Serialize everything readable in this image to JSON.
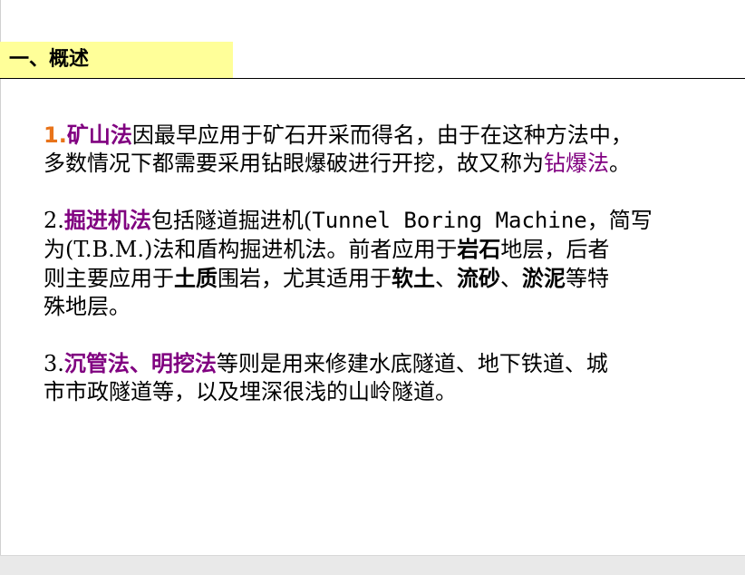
{
  "title": "一、概述",
  "p1": {
    "num": "1.",
    "term": "矿山法",
    "text1": "因最早应用于矿石开采而得名，由于在这种方法中，",
    "text2": "多数情况下都需要采用钻眼爆破进行开挖，故又称为",
    "term2": "钻爆法",
    "end": "。"
  },
  "p2": {
    "num": "2.",
    "term": "掘进机法",
    "text1": "包括隧道掘进机(",
    "english": "Tunnel Boring Machine",
    "text1b": "，简写",
    "text2a": "为(",
    "abbr": "T.B.M.",
    "text2b": ")法和盾构掘进机法。前者应用于",
    "rock": "岩石",
    "text2c": "地层，后者",
    "text3a": "则主要应用于",
    "soil": "土质",
    "text3b": "围岩，尤其适用于",
    "soft": "软土",
    "sep1": "、",
    "sand": "流砂",
    "sep2": "、",
    "silt": "淤泥",
    "text3c": "等特",
    "text4": "殊地层。"
  },
  "p3": {
    "num": "3.",
    "term": "沉管法、明挖法",
    "text1": "等则是用来修建水底隧道、地下铁道、城",
    "text2": "市市政隧道等，以及埋深很浅的山岭隧道。"
  }
}
